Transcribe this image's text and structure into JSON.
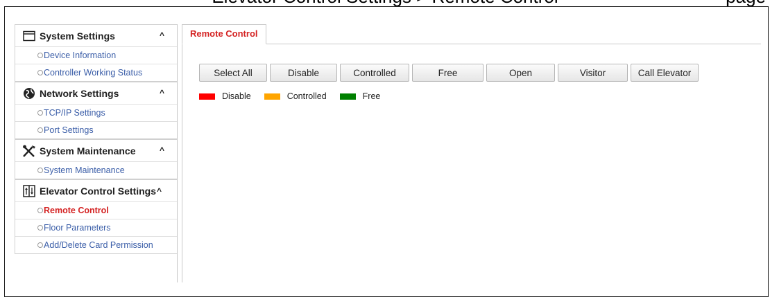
{
  "caption": {
    "text": "Elevator Control Settings > Remote Control",
    "right_text": "page"
  },
  "sidebar": {
    "groups": [
      {
        "title": "System Settings",
        "icon": "window-icon",
        "items": [
          {
            "label": "Device Information",
            "active": false
          },
          {
            "label": "Controller Working Status",
            "active": false
          }
        ]
      },
      {
        "title": "Network Settings",
        "icon": "globe-icon",
        "items": [
          {
            "label": "TCP/IP Settings",
            "active": false
          },
          {
            "label": "Port Settings",
            "active": false
          }
        ]
      },
      {
        "title": "System Maintenance",
        "icon": "tools-icon",
        "items": [
          {
            "label": "System Maintenance",
            "active": false
          }
        ]
      },
      {
        "title": "Elevator Control Settings",
        "icon": "elevator-icon",
        "items": [
          {
            "label": "Remote Control",
            "active": true
          },
          {
            "label": "Floor Parameters",
            "active": false
          },
          {
            "label": "Add/Delete Card Permission",
            "active": false
          }
        ]
      }
    ],
    "caret": "^"
  },
  "main": {
    "tab_label": "Remote Control",
    "buttons": [
      "Select All",
      "Disable",
      "Controlled",
      "Free",
      "Open",
      "Visitor",
      "Call Elevator"
    ],
    "legend": [
      {
        "label": "Disable",
        "color": "#ff0000"
      },
      {
        "label": "Controlled",
        "color": "#ffa500"
      },
      {
        "label": "Free",
        "color": "#008000"
      }
    ]
  },
  "colors": {
    "accent_red": "#d42323",
    "link_blue": "#3b5ea8"
  }
}
